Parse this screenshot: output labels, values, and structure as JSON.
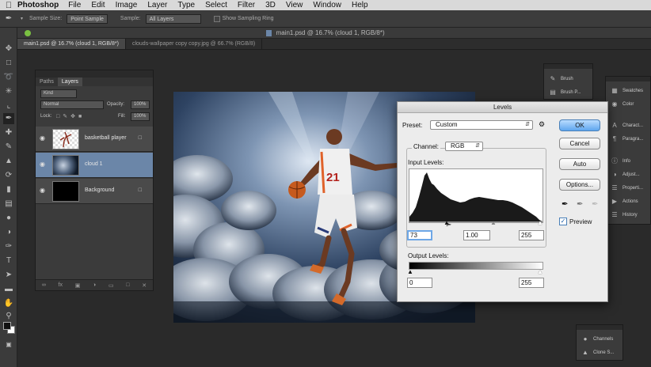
{
  "menubar": {
    "app_name": "Photoshop",
    "items": [
      "File",
      "Edit",
      "Image",
      "Layer",
      "Type",
      "Select",
      "Filter",
      "3D",
      "View",
      "Window",
      "Help"
    ]
  },
  "options_bar": {
    "sample_size_label": "Sample Size:",
    "sample_size_value": "Point Sample",
    "sample_label": "Sample:",
    "sample_value": "All Layers",
    "show_ring_label": "Show Sampling Ring"
  },
  "window": {
    "title": "main1.psd @ 16.7% (cloud 1, RGB/8*)"
  },
  "doc_tabs": [
    {
      "label": "main1.psd @ 16.7% (cloud 1, RGB/8*)",
      "active": true
    },
    {
      "label": "clouds-wallpaper copy copy.jpg @ 66.7% (RGB/8)",
      "active": false
    }
  ],
  "layers_panel": {
    "tabs": [
      "Paths",
      "Layers"
    ],
    "filter_label": "Kind",
    "blend_mode": "Normal",
    "opacity_label": "Opacity:",
    "opacity_value": "100%",
    "lock_label": "Lock:",
    "fill_label": "Fill:",
    "fill_value": "100%",
    "layers": [
      {
        "name": "basketball player",
        "selected": false,
        "locked": true
      },
      {
        "name": "cloud 1",
        "selected": true,
        "locked": false
      },
      {
        "name": "Background",
        "selected": false,
        "locked": true
      }
    ]
  },
  "right_dock": {
    "group1": [
      "Brush",
      "Brush P..."
    ],
    "group2": [
      "Swatches",
      "Color",
      "Charact...",
      "Paragra...",
      "Info",
      "Adjust...",
      "Properti...",
      "Actions",
      "History"
    ],
    "group3": [
      "Channels",
      "Clone S..."
    ]
  },
  "levels": {
    "title": "Levels",
    "preset_label": "Preset:",
    "preset_value": "Custom",
    "channel_label": "Channel:",
    "channel_value": "RGB",
    "input_levels_label": "Input Levels:",
    "input_black": "73",
    "input_gamma": "1.00",
    "input_white": "255",
    "output_levels_label": "Output Levels:",
    "output_black": "0",
    "output_white": "255",
    "buttons": {
      "ok": "OK",
      "cancel": "Cancel",
      "auto": "Auto",
      "options": "Options..."
    },
    "preview_label": "Preview",
    "preview_checked": true,
    "accent_color": "#5ea6ee"
  },
  "canvas": {
    "jersey_number": "21"
  }
}
